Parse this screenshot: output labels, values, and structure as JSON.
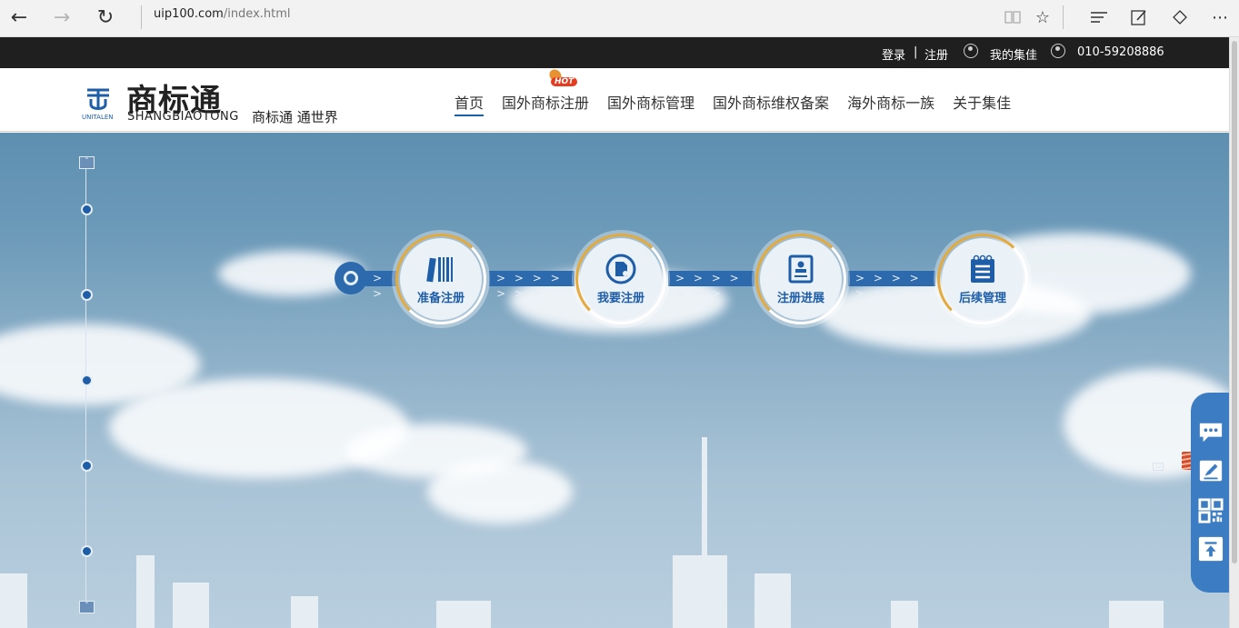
{
  "browser": {
    "url_host": "uip100.com",
    "url_path": "/index.html"
  },
  "topbar": {
    "login": "登录",
    "divider": "|",
    "register": "注册",
    "my_account": "我的集佳",
    "phone": "010-59208886"
  },
  "header": {
    "logo_cn": "商标通",
    "logo_en": "SHANGBIAOTONG",
    "logo_brand": "UNITALEN",
    "slogan": "商标通 通世界",
    "hot_badge": "HOT",
    "nav": [
      {
        "label": "首页",
        "active": true
      },
      {
        "label": "国外商标注册"
      },
      {
        "label": "国外商标管理"
      },
      {
        "label": "国外商标维权备案"
      },
      {
        "label": "海外商标一族"
      },
      {
        "label": "关于集佳"
      }
    ]
  },
  "process": {
    "arrows": "> > > > > > >",
    "steps": [
      {
        "label": "准备注册",
        "icon": "books-icon"
      },
      {
        "label": "我要注册",
        "icon": "register-document-icon"
      },
      {
        "label": "注册进展",
        "icon": "id-card-icon"
      },
      {
        "label": "后续管理",
        "icon": "notepad-icon"
      }
    ]
  },
  "side_tools": {
    "icons": [
      "chat-icon",
      "edit-icon",
      "qrcode-icon",
      "back-to-top-icon"
    ]
  },
  "colors": {
    "brand_blue": "#1e5ea8",
    "accent_orange": "#e8912e",
    "topbar_bg": "#1f1f1f"
  }
}
